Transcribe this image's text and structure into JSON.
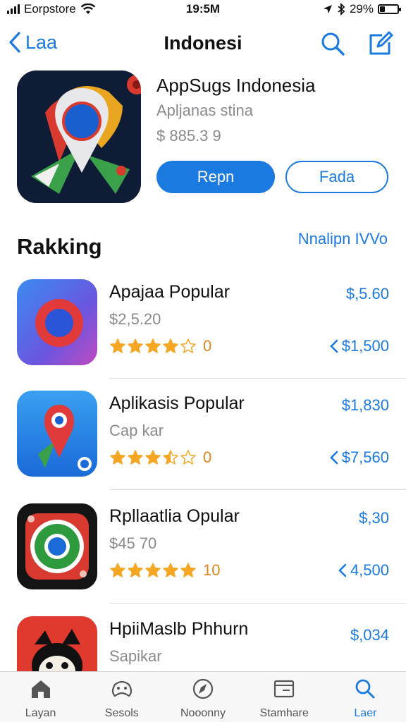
{
  "status_bar": {
    "carrier": "Eorpstore",
    "time": "19:5M",
    "battery": "29%",
    "battery_level": 0.29
  },
  "nav": {
    "back_label": "Laa",
    "title": "Indonesi",
    "search_icon": "search-icon",
    "compose_icon": "compose-icon"
  },
  "featured": {
    "title": "AppSugs Indonesia",
    "subtitle": "Apljanas stina",
    "price": "$ 885.3 9",
    "primary_button": "Repn",
    "secondary_button": "Fada"
  },
  "section": {
    "title": "Rakking",
    "link": "Nnalipn IVVo"
  },
  "apps": [
    {
      "name": "Apajaa Popular",
      "subtitle": "$2,5.20",
      "rating": 4,
      "rating_count": "0",
      "price": "$,5.60",
      "action": "$1,500",
      "accent": "#e03a3a"
    },
    {
      "name": "Aplikasis Popular",
      "subtitle": "Cap kar",
      "rating": 3.5,
      "rating_count": "0",
      "price": "$1,830",
      "action": "$7,560",
      "accent": "#1a7ae0"
    },
    {
      "name": "Rpllaatlia Opular",
      "subtitle": "$45 70",
      "rating": 5,
      "rating_count": "10",
      "price": "$,30",
      "action": "4,500",
      "accent": "#2e9a3e"
    },
    {
      "name": "HpiiMaslb Phhurn",
      "subtitle": "Sapikar",
      "rating": 0,
      "rating_count": "",
      "price": "$,034",
      "action": "",
      "accent": "#e0392e"
    }
  ],
  "tabs": [
    {
      "label": "Layan",
      "icon": "home-icon",
      "active": false
    },
    {
      "label": "Sesols",
      "icon": "game-controller-icon",
      "active": false
    },
    {
      "label": "Nooonny",
      "icon": "compass-icon",
      "active": false
    },
    {
      "label": "Stamhare",
      "icon": "browser-window-icon",
      "active": false
    },
    {
      "label": "Laer",
      "icon": "search-icon",
      "active": true
    }
  ],
  "colors": {
    "accent": "#1a7ae0",
    "star": "#f5a623",
    "muted": "#8a8a8e"
  }
}
